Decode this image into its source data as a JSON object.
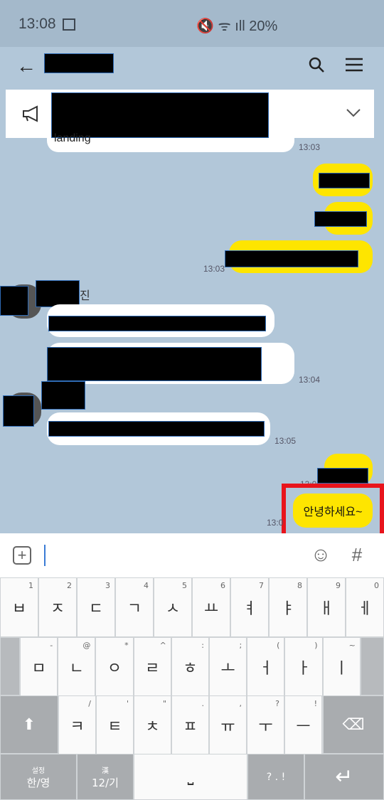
{
  "status": {
    "time": "13:08",
    "right": "🔇 ᯤ ıll 20%"
  },
  "chat": {
    "first_msg_tail": "landing",
    "ts_1303a": "13:03",
    "ts_1303b": "13:03",
    "ts_1304": "13:04",
    "ts_1305": "13:05",
    "ts_13xx": "13:0",
    "ts_13xy": "13:0",
    "sender1_tail": "진",
    "last_msg": "안녕하세요~"
  },
  "input": {
    "plus": "+",
    "emoji": "☺",
    "hash": "#"
  },
  "keyboard": {
    "row1": [
      [
        "ㅂ",
        "1"
      ],
      [
        "ㅈ",
        "2"
      ],
      [
        "ㄷ",
        "3"
      ],
      [
        "ㄱ",
        "4"
      ],
      [
        "ㅅ",
        "5"
      ],
      [
        "ㅛ",
        "6"
      ],
      [
        "ㅕ",
        "7"
      ],
      [
        "ㅑ",
        "8"
      ],
      [
        "ㅐ",
        "9"
      ],
      [
        "ㅔ",
        "0"
      ]
    ],
    "row2": [
      [
        "ㅁ",
        "-"
      ],
      [
        "ㄴ",
        "@"
      ],
      [
        "ㅇ",
        "*"
      ],
      [
        "ㄹ",
        "^"
      ],
      [
        "ㅎ",
        ":"
      ],
      [
        "ㅗ",
        ";"
      ],
      [
        "ㅓ",
        "("
      ],
      [
        "ㅏ",
        ")"
      ],
      [
        "ㅣ",
        "~"
      ]
    ],
    "row3": [
      [
        "ㅋ",
        "/"
      ],
      [
        "ㅌ",
        "'"
      ],
      [
        "ㅊ",
        "\""
      ],
      [
        "ㅍ",
        "."
      ],
      [
        "ㅠ",
        ","
      ],
      [
        "ㅜ",
        "?"
      ],
      [
        "ㅡ",
        "!"
      ]
    ],
    "lang": "한/영",
    "lang_top": "설정",
    "num": "12/기",
    "num_top": "漢",
    "space": "⎵",
    "punct": "? . !",
    "enter": "↵",
    "shift": "⬆",
    "backspace": "⌫"
  }
}
